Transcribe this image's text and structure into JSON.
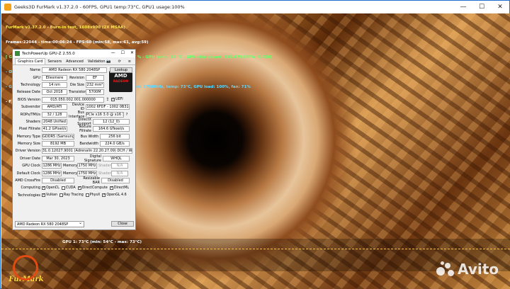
{
  "window": {
    "title": "Geeks3D FurMark v1.37.2.0 - 60FPS, GPU1 temp:73°C, GPU1 usage:100%"
  },
  "osd": {
    "line1": "FurMark v1.37.2.0 - Burn-in test, 1608x900 (2X MSAA)",
    "line2": "Frames:22044 - time:00:06:24 - FPS:60 (min:58, max:61, avg:59)",
    "line3": "[ GPU-Z ] core: 1286 MHz - mem: 1750 MHz - GPU load: 100 % - GPU temp: 73 °C - GPU chip power: 115.4 W (PPW: 0.520)",
    "line4": "- OpenGL renderer: AMD Radeon(tm) RX 580 2048SP",
    "line5": "- GPU 1 (AMD Radeon RX 580 2048SP) - core: 1286MHz, mem: 1750MHz, temp: 73°C, GPU load: 100%, fan: 71%",
    "line6": "- F1: toggle help"
  },
  "graph": {
    "label": "GPU 1: 73°C (min: 54°C - max: 73°C)"
  },
  "logo_text": "FurMark",
  "watermark": "Avito",
  "gpuz": {
    "title": "TechPowerUp GPU-Z 2.55.0",
    "tabs": [
      "Graphics Card",
      "Sensors",
      "Advanced",
      "Validation"
    ],
    "name": "AMD Radeon RX 580 2048SP",
    "lookup": "Lookup",
    "gpu": "Ellesmere",
    "revision": "EF",
    "technology": "14 nm",
    "die_size": "232 mm²",
    "release_date": "Oct 2018",
    "transistors": "5700M",
    "bios_version": "015.050.002.001.000000",
    "uefi": "UEFI",
    "subvendor": "AMD/ATI",
    "device_id": "1002 6FDF - 1002 0B31",
    "rops_tmus": "32 / 128",
    "bus_interface": "PCIe x16 3.0 @ x16 3.0",
    "shaders": "2048 Unified",
    "directx_support": "12 (12_0)",
    "pixel_fillrate": "41.2 GPixel/s",
    "texture_fillrate": "164.6 GTexel/s",
    "memory_type": "GDDR5 (Samsung)",
    "bus_width": "256 bit",
    "memory_size": "8192 MB",
    "bandwidth": "224.0 GB/s",
    "driver_version": "31.0.12027.9001 (Adrenalin 22.20.27.09) DCH / Win10 64",
    "driver_date": "Mar 30, 2023",
    "digital_signature": "WHQL",
    "gpu_clock": "1286 MHz",
    "memory_clock": "1750 MHz",
    "shader_clock": "N/A",
    "default_clock": "1286 MHz",
    "default_memory": "1750 MHz",
    "default_shader": "N/A",
    "crossfire": "Disabled",
    "resizable_bar": "Disabled",
    "labels": {
      "name": "Name",
      "gpu": "GPU",
      "revision": "Revision",
      "technology": "Technology",
      "die_size": "Die Size",
      "release_date": "Release Date",
      "transistors": "Transistors",
      "bios": "BIOS Version",
      "subvendor": "Subvendor",
      "device_id": "Device ID",
      "rops": "ROPs/TMUs",
      "bus": "Bus Interface",
      "shaders": "Shaders",
      "directx": "DirectX Support",
      "pixel": "Pixel Fillrate",
      "texture": "Texture Fillrate",
      "memtype": "Memory Type",
      "buswidth": "Bus Width",
      "memsize": "Memory Size",
      "bandwidth": "Bandwidth",
      "driver_version": "Driver Version",
      "driver_date": "Driver Date",
      "digsig": "Digital Signature",
      "gpu_clock": "GPU Clock",
      "memory": "Memory",
      "shader": "Shader",
      "default_clock": "Default Clock",
      "crossfire": "AMD CrossFire",
      "rebar": "Resizable BAR",
      "computing": "Computing",
      "technologies": "Technologies"
    },
    "computing": [
      {
        "label": "OpenCL",
        "on": true
      },
      {
        "label": "CUDA",
        "on": false
      },
      {
        "label": "DirectCompute",
        "on": true
      },
      {
        "label": "DirectML",
        "on": true
      }
    ],
    "technologies": [
      {
        "label": "Vulkan",
        "on": true
      },
      {
        "label": "Ray Tracing",
        "on": false
      },
      {
        "label": "PhysX",
        "on": false
      },
      {
        "label": "OpenGL 4.6",
        "on": true
      }
    ],
    "selected_gpu": "AMD Radeon RX 580 2048SP",
    "close": "Close",
    "amd_logo": "AMD",
    "radeon_logo": "RADEON"
  }
}
